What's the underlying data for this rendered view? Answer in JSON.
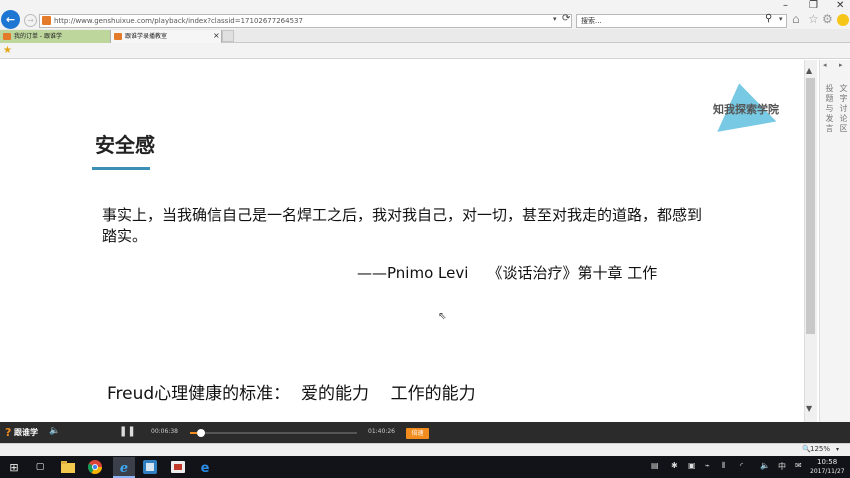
{
  "browser": {
    "url": "http://www.genshuixue.com/playback/index?classid=17102677264537",
    "search_placeholder": "搜索...",
    "window_controls": {
      "minimize": "–",
      "maximize": "❐",
      "close": "✕"
    },
    "icons": {
      "back": "←",
      "forward": "→",
      "refresh": "⟳",
      "dropdown": "▾",
      "search": "⚲",
      "home": "⌂",
      "favorites": "☆",
      "settings": "⚙"
    },
    "tabs": [
      {
        "label": "我的订单 - 跟谁学",
        "active": false
      },
      {
        "label": "跟谁学录播教室",
        "active": true
      }
    ],
    "tab_close": "×"
  },
  "page": {
    "logo_text": "知我探索学院",
    "heading": "安全感",
    "quote": "事实上，当我确信自己是一名焊工之后，我对我自己，对一切，甚至对我走的道路，都感到踏实。",
    "citation": "——Pnimo Levi    《谈话治疗》第十章 工作",
    "freud": "Freud心理健康的标准：  爱的能力    工作的能力"
  },
  "scrollbar": {
    "up": "▲",
    "down": "▼",
    "position_fraction": 0.05
  },
  "side_panel": {
    "arrow_left": "◂",
    "arrow_right": "▸",
    "tab_1": "投 题 与 发 言",
    "tab_2": "文 字 讨 论 区"
  },
  "player": {
    "logo_mark": "?",
    "logo": "跟谁学",
    "volume_icon": "🔈",
    "pause_icon": "❚❚",
    "current_time": "00:06:38",
    "total_time": "01:40:26",
    "progress_fraction": 0.066,
    "speed_label": "倍速"
  },
  "status_bar": {
    "zoom_icon": "🔍",
    "zoom": "125%",
    "dropdown": "▾"
  },
  "taskbar": {
    "start_icon": "⊞",
    "taskview_icon": "▢",
    "apps": [
      "file-explorer",
      "chrome",
      "internet-explorer",
      "app",
      "app",
      "edge"
    ],
    "tray_ime": "中",
    "tray_icons": [
      "▤",
      "✱",
      "▣",
      "⌁",
      "⫴",
      "◜",
      "🔈",
      "⌨",
      "✉"
    ],
    "time": "10:58",
    "date": "2017/11/27"
  },
  "colors": {
    "accent": "#3c8fb5",
    "player_orange": "#f28c1f",
    "logo_blue": "#78c9e3"
  }
}
